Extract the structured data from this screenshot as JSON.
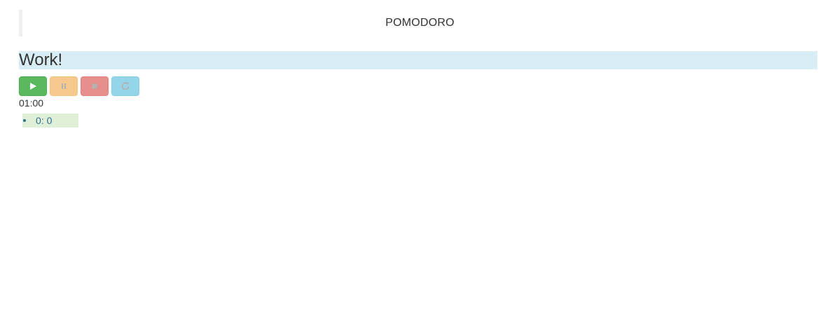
{
  "header": {
    "title": "POMODORO"
  },
  "mode": {
    "label": "Work!"
  },
  "controls": {
    "play": {
      "icon": "play-icon",
      "color": "#5cb85c"
    },
    "pause": {
      "icon": "pause-icon",
      "color": "#f0ad4e"
    },
    "stop": {
      "icon": "stop-icon",
      "color": "#d9534f"
    },
    "reset": {
      "icon": "refresh-icon",
      "color": "#5bc0de"
    }
  },
  "timer": {
    "display": "01:00"
  },
  "sessions": {
    "items": [
      {
        "label": "0: 0"
      }
    ]
  },
  "colors": {
    "mode_bar": "#d9edf7",
    "session_item": "#dff0d8",
    "session_text": "#31708f"
  }
}
